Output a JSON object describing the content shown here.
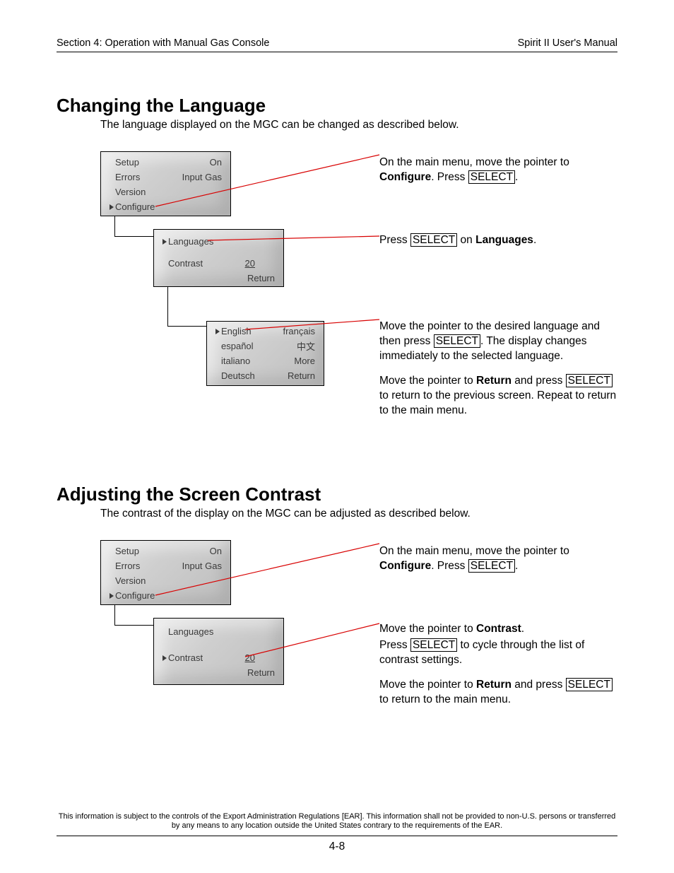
{
  "header": {
    "left": "Section 4: Operation with Manual Gas Console",
    "right": "Spirit II User's Manual"
  },
  "sections": {
    "lang": {
      "title": "Changing the Language",
      "intro": "The language displayed on the MGC can be changed as described below."
    },
    "contrast": {
      "title": "Adjusting the Screen Contrast",
      "intro": "The contrast of the display on the MGC can be adjusted as described below."
    }
  },
  "lcd": {
    "main": {
      "r1a": "Setup",
      "r1b": "On",
      "r2a": "Errors",
      "r2b": "Input Gas",
      "r3a": "Version",
      "r4a": "Configure"
    },
    "cfg": {
      "r1a": "Languages",
      "r2a": "Contrast",
      "r2b": "20",
      "r3b": "Return"
    },
    "langlist": {
      "r1a": "English",
      "r1b": "français",
      "r2a": "español",
      "r2b": "中文",
      "r3a": "italiano",
      "r3b": "More",
      "r4a": "Deutsch",
      "r4b": "Return"
    }
  },
  "keys": {
    "select": "SELECT"
  },
  "steps": {
    "lang1": {
      "t1": "On the main menu, move the pointer to ",
      "bold": "Configure",
      "t2": ".  Press ",
      "t3": "."
    },
    "lang2": {
      "t1": "Press ",
      "t2": " on ",
      "bold": "Languages",
      "t3": "."
    },
    "lang3a": {
      "t1": "Move the pointer to the desired language and then press ",
      "t2": ".  The display changes immediately to the selected language."
    },
    "lang3b": {
      "t1": "Move the pointer to ",
      "bold": "Return",
      "t2": " and press ",
      "t3": " to return to the previous screen.  Repeat to return to the main menu."
    },
    "con1": {
      "t1": "On the main menu, move the pointer to ",
      "bold": "Configure",
      "t2": ".  Press ",
      "t3": "."
    },
    "con2a": {
      "t1": "Move the pointer to ",
      "bold": "Contrast",
      "t2": "."
    },
    "con2b": {
      "t1": "Press ",
      "t2": " to cycle through the list of contrast settings."
    },
    "con2c": {
      "t1": "Move the pointer to ",
      "bold": "Return",
      "t2": " and press ",
      "t3": " to return to the main menu."
    }
  },
  "footer": {
    "disclaimer": "This information is subject to the controls of the Export Administration Regulations [EAR].  This information shall not be provided to non-U.S. persons or transferred by any means to any location outside the United States contrary to the requirements of the EAR.",
    "pagenum": "4-8"
  }
}
